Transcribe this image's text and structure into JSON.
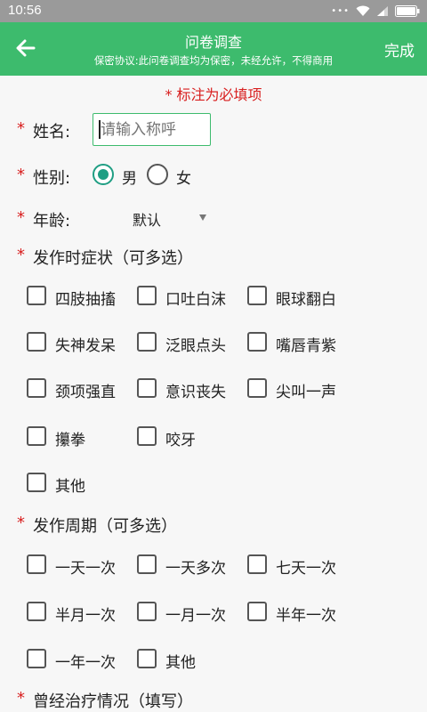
{
  "status": {
    "time": "10:56"
  },
  "header": {
    "title": "问卷调查",
    "subtitle": "保密协议:此问卷调查均为保密，未经允许，不得商用",
    "done_label": "完成"
  },
  "form": {
    "required_note": "* 标注为必填项",
    "required_mark": "*",
    "name_label": "姓名:",
    "name_placeholder": "请输入称呼",
    "gender_label": "性别:",
    "gender_male": "男",
    "gender_female": "女",
    "age_label": "年龄:",
    "age_value": "默认",
    "symptoms_label": "发作时症状（可多选）",
    "symptoms": [
      "四肢抽搐",
      "口吐白沫",
      "眼球翻白",
      "失神发呆",
      "泛眼点头",
      "嘴唇青紫",
      "颈项强直",
      "意识丧失",
      "尖叫一声",
      "攥拳",
      "咬牙",
      "其他"
    ],
    "period_label": "发作周期（可多选）",
    "periods": [
      "一天一次",
      "一天多次",
      "七天一次",
      "半月一次",
      "一月一次",
      "半年一次",
      "一年一次",
      "其他"
    ],
    "treatment_label": "曾经治疗情况（填写）"
  }
}
